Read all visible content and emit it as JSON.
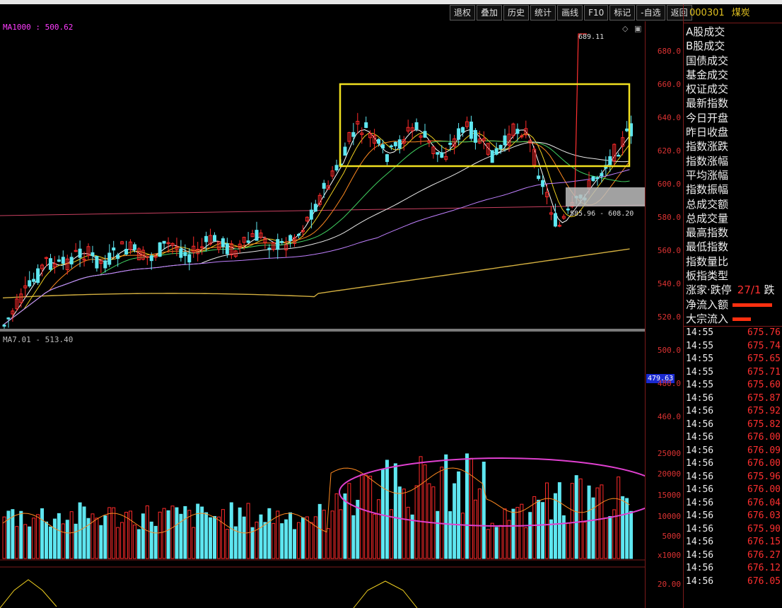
{
  "toolbar": {
    "buttons": [
      "退权",
      "叠加",
      "历史",
      "统计",
      "画线",
      "F10",
      "标记",
      "-自选",
      "返回"
    ]
  },
  "main_chart": {
    "ma_label": "MA1000 : 500.62",
    "sub_label": "MA7.01 - 513.40",
    "peak_label": "689.11",
    "range_label": "585.96 - 608.20",
    "current_tag": "479.63",
    "price_axis": [
      "680.0",
      "660.0",
      "640.0",
      "620.0",
      "600.0",
      "580.0",
      "560.0",
      "540.0",
      "520.0",
      "500.0",
      "480.0",
      "460.0"
    ],
    "volume_axis": [
      "25000",
      "20000",
      "15000",
      "10000",
      "5000",
      "x1000"
    ],
    "indicator_axis": [
      "20.00"
    ]
  },
  "right_panel": {
    "code": "000301",
    "name": "煤炭",
    "rows": [
      "A股成交",
      "B股成交",
      "国债成交",
      "基金成交",
      "权证成交",
      "最新指数",
      "今日开盘",
      "昨日收盘",
      "指数涨跌",
      "指数涨幅",
      "平均涨幅",
      "指数振幅",
      "总成交额",
      "总成交量",
      "最高指数",
      "最低指数",
      "指数量比",
      "板指类型",
      "涨家·跌停",
      "净流入额",
      "大宗流入"
    ],
    "rise_fall_value": "27/1",
    "rise_fall_suffix": "跌",
    "ticks": [
      {
        "time": "14:55",
        "price": "675.76"
      },
      {
        "time": "14:55",
        "price": "675.74"
      },
      {
        "time": "14:55",
        "price": "675.65"
      },
      {
        "time": "14:55",
        "price": "675.71"
      },
      {
        "time": "14:55",
        "price": "675.60"
      },
      {
        "time": "14:56",
        "price": "675.87"
      },
      {
        "time": "14:56",
        "price": "675.92"
      },
      {
        "time": "14:56",
        "price": "675.82"
      },
      {
        "time": "14:56",
        "price": "676.00"
      },
      {
        "time": "14:56",
        "price": "676.09"
      },
      {
        "time": "14:56",
        "price": "676.00"
      },
      {
        "time": "14:56",
        "price": "675.96"
      },
      {
        "time": "14:56",
        "price": "676.00"
      },
      {
        "time": "14:56",
        "price": "676.04"
      },
      {
        "time": "14:56",
        "price": "676.03"
      },
      {
        "time": "14:56",
        "price": "675.90"
      },
      {
        "time": "14:56",
        "price": "676.15"
      },
      {
        "time": "14:56",
        "price": "676.27"
      },
      {
        "time": "14:56",
        "price": "676.12"
      },
      {
        "time": "14:56",
        "price": "676.05"
      }
    ]
  },
  "colors": {
    "up": "#ff2a2a",
    "down": "#5ee6f0",
    "box": "#f0e020",
    "ellipse": "#e040d0",
    "ma_long": "#d4b040"
  }
}
